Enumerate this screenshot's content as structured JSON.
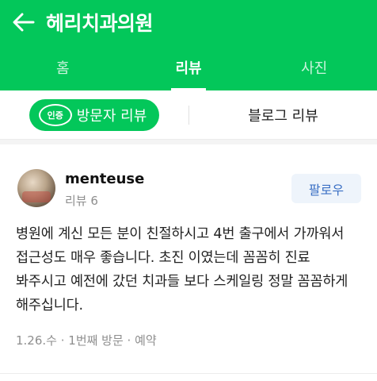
{
  "header": {
    "title": "헤리치과의원",
    "back_icon": "arrow-left-icon"
  },
  "tabs": [
    {
      "label": "홈",
      "active": false
    },
    {
      "label": "리뷰",
      "active": true
    },
    {
      "label": "사진",
      "active": false
    }
  ],
  "subtabs": {
    "visitor_badge": "인증",
    "visitor_label": "방문자 리뷰",
    "blog_label": "블로그 리뷰"
  },
  "review": {
    "username": "menteuse",
    "review_count": "리뷰 6",
    "follow_label": "팔로우",
    "text": "병원에 계신 모든 분이 친절하시고 4번 출구에서 가까워서 접근성도 매우 좋습니다. 초진 이였는데 꼼꼼히 진료 봐주시고 예전에 갔던 치과들 보다 스케일링 정말 꼼꼼하게 해주십니다.",
    "meta": "1.26.수 · 1번째 방문 · 예약"
  },
  "colors": {
    "brand": "#03c75a",
    "follow_text": "#3a6fc4",
    "follow_bg": "#eef4fb"
  }
}
